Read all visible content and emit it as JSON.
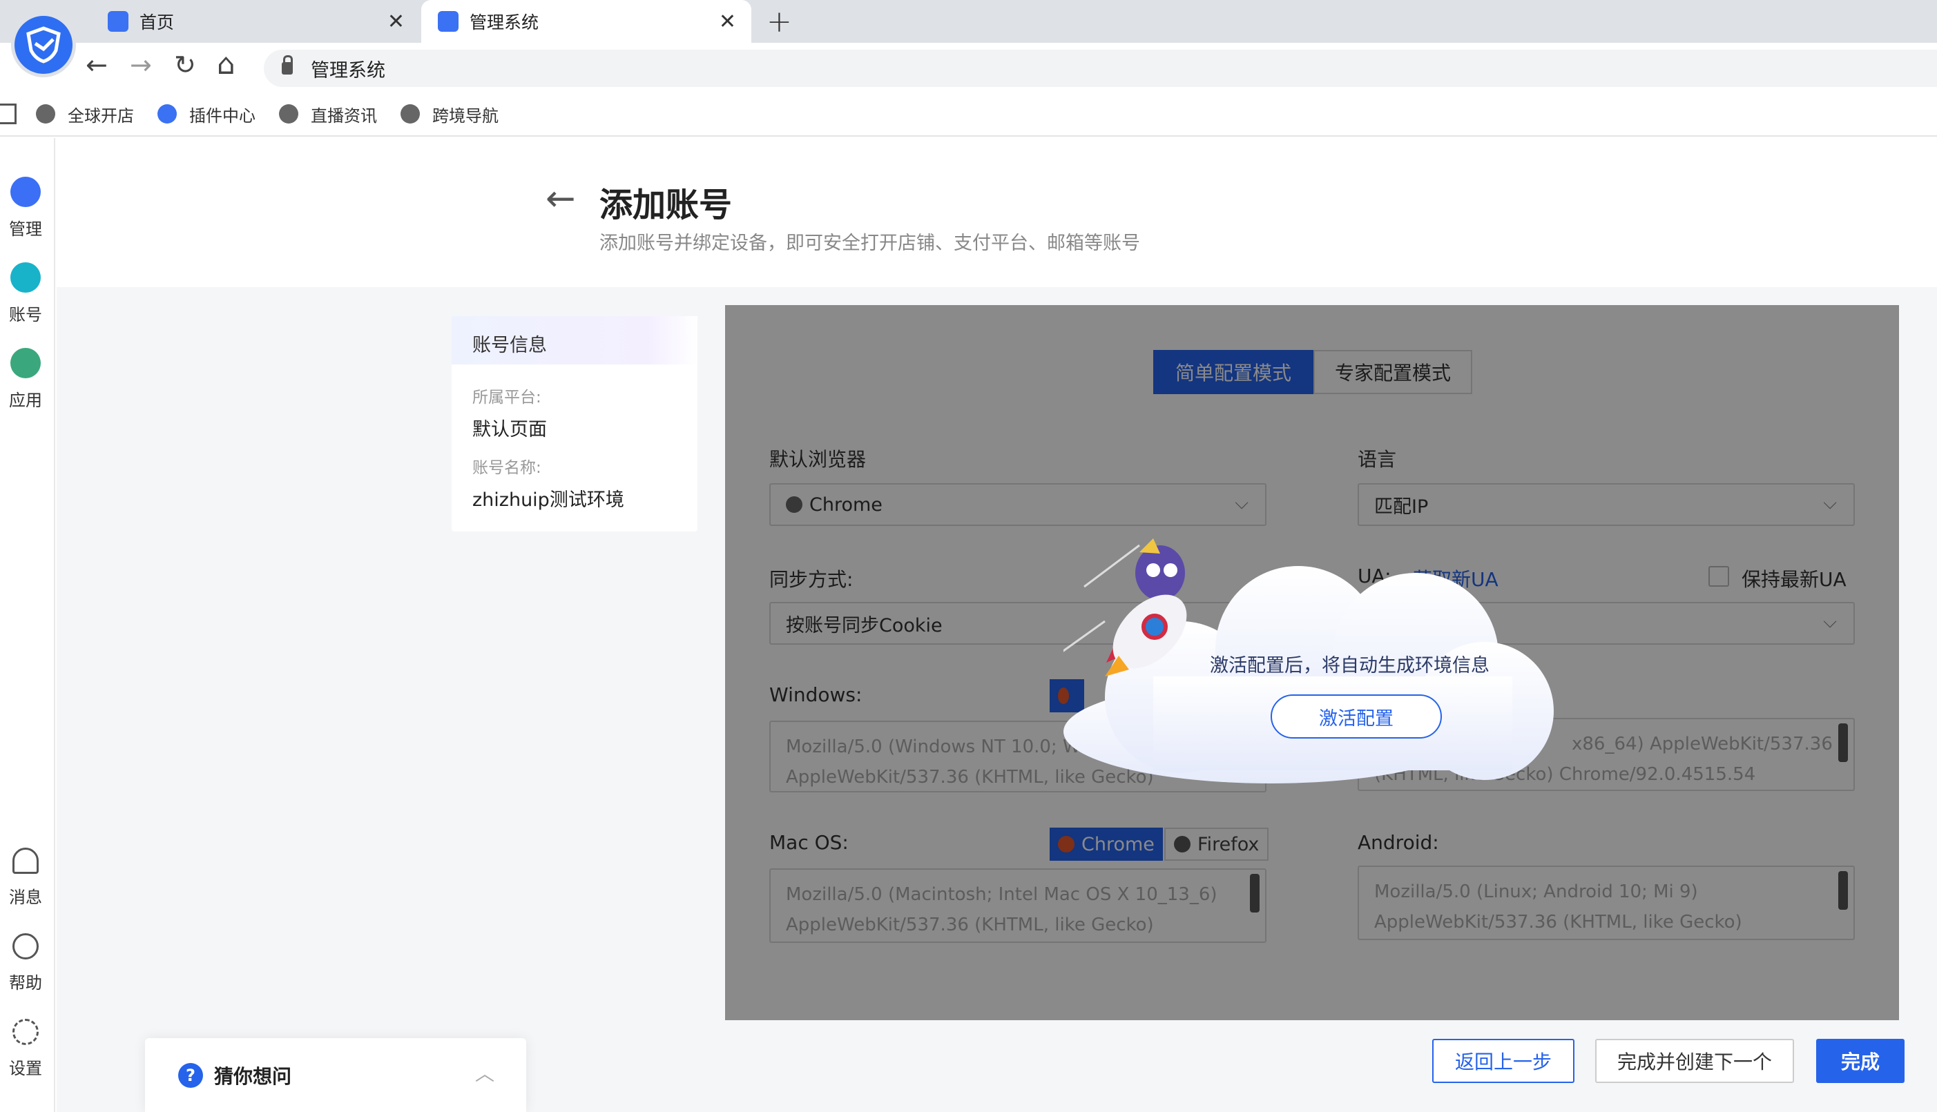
{
  "browser": {
    "tabs": [
      {
        "label": "首页",
        "close": "✕"
      },
      {
        "label": "管理系统",
        "close": "✕"
      }
    ],
    "new_tab": "+",
    "address": "管理系统",
    "nav": {
      "back": "←",
      "forward": "→",
      "reload": "↻",
      "home": "⌂"
    },
    "bookmarks": [
      "全球开店",
      "插件中心",
      "直播资讯",
      "跨境导航"
    ],
    "accent": "#2e6ef2"
  },
  "sidebar": {
    "top_items": [
      {
        "label": "管理",
        "icon": "grid-icon"
      },
      {
        "label": "账号",
        "icon": "account-icon"
      },
      {
        "label": "应用",
        "icon": "apps-icon"
      }
    ],
    "bottom_items": [
      {
        "label": "消息",
        "icon": "bell-icon"
      },
      {
        "label": "帮助",
        "icon": "help-icon"
      },
      {
        "label": "设置",
        "icon": "gear-icon"
      }
    ]
  },
  "header": {
    "back": "←",
    "title": "添加账号",
    "subtitle": "添加账号并绑定设备，即可安全打开店铺、支付平台、邮箱等账号"
  },
  "info_card": {
    "title": "账号信息",
    "platform_label": "所属平台:",
    "platform_value": "默认页面",
    "name_label": "账号名称:",
    "name_value": "zhizhuip测试环境"
  },
  "form": {
    "mode_simple": "简单配置模式",
    "mode_expert": "专家配置模式",
    "browser_label": "默认浏览器",
    "browser_value": "Chrome",
    "language_label": "语言",
    "language_value": "匹配IP",
    "sync_label": "同步方式:",
    "sync_value": "按账号同步Cookie",
    "ua_label": "UA:",
    "ua_link": "获取新UA",
    "keep_ua_label": "保持最新UA",
    "windows_label": "Windows:",
    "windows_ua": "Mozilla/5.0 (Windows NT 10.0; WO",
    "windows_ua2": "AppleWebKit/537.36 (KHTML, like Gecko)",
    "right_ua_1": "x86_64) AppleWebKit/537.36",
    "right_ua_2": "(KHTML, like Gecko) Chrome/92.0.4515.54",
    "mac_label": "Mac OS:",
    "mac_chrome": "Chrome",
    "mac_firefox": "Firefox",
    "mac_ua_1": "Mozilla/5.0 (Macintosh; Intel Mac OS X 10_13_6)",
    "mac_ua_2": "AppleWebKit/537.36 (KHTML, like Gecko)",
    "android_label": "Android:",
    "android_ua_1": "Mozilla/5.0 (Linux; Android  10; Mi 9)",
    "android_ua_2": "AppleWebKit/537.36 (KHTML, like Gecko)",
    "primary_color": "#2563eb"
  },
  "popup": {
    "message": "激活配置后，将自动生成环境信息",
    "button": "激活配置"
  },
  "footer": {
    "back": "返回上一步",
    "next": "完成并创建下一个",
    "done": "完成",
    "guess": "猜你想问",
    "guess_icon": "?"
  }
}
